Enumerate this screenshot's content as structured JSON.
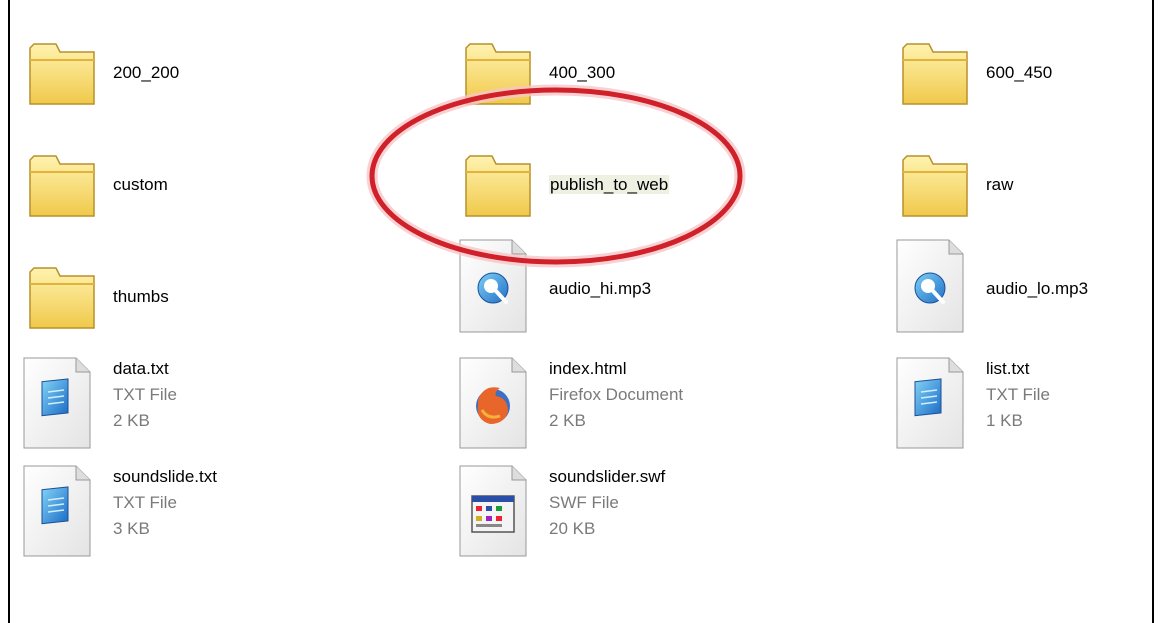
{
  "folders": [
    {
      "name": "200_200",
      "icon": "folder-icon"
    },
    {
      "name": "400_300",
      "icon": "folder-icon"
    },
    {
      "name": "600_450",
      "icon": "folder-icon"
    },
    {
      "name": "custom",
      "icon": "folder-icon"
    },
    {
      "name": "publish_to_web",
      "icon": "folder-icon",
      "selected": true
    },
    {
      "name": "raw",
      "icon": "folder-icon"
    },
    {
      "name": "thumbs",
      "icon": "folder-icon"
    }
  ],
  "files": [
    {
      "name": "audio_hi.mp3",
      "icon": "quicktime-audio-icon"
    },
    {
      "name": "audio_lo.mp3",
      "icon": "quicktime-audio-icon"
    },
    {
      "name": "data.txt",
      "type": "TXT File",
      "size": "2 KB",
      "icon": "text-file-icon"
    },
    {
      "name": "index.html",
      "type": "Firefox Document",
      "size": "2 KB",
      "icon": "firefox-document-icon"
    },
    {
      "name": "list.txt",
      "type": "TXT File",
      "size": "1 KB",
      "icon": "text-file-icon"
    },
    {
      "name": "soundslide.txt",
      "type": "TXT File",
      "size": "3 KB",
      "icon": "text-file-icon"
    },
    {
      "name": "soundslider.swf",
      "type": "SWF File",
      "size": "20 KB",
      "icon": "swf-file-icon"
    }
  ],
  "colors": {
    "highlight_ellipse": "#d0202a",
    "folder_fill": "#f6d86a",
    "folder_edge": "#b8902a",
    "selected_label_bg": "#eef0e2"
  }
}
